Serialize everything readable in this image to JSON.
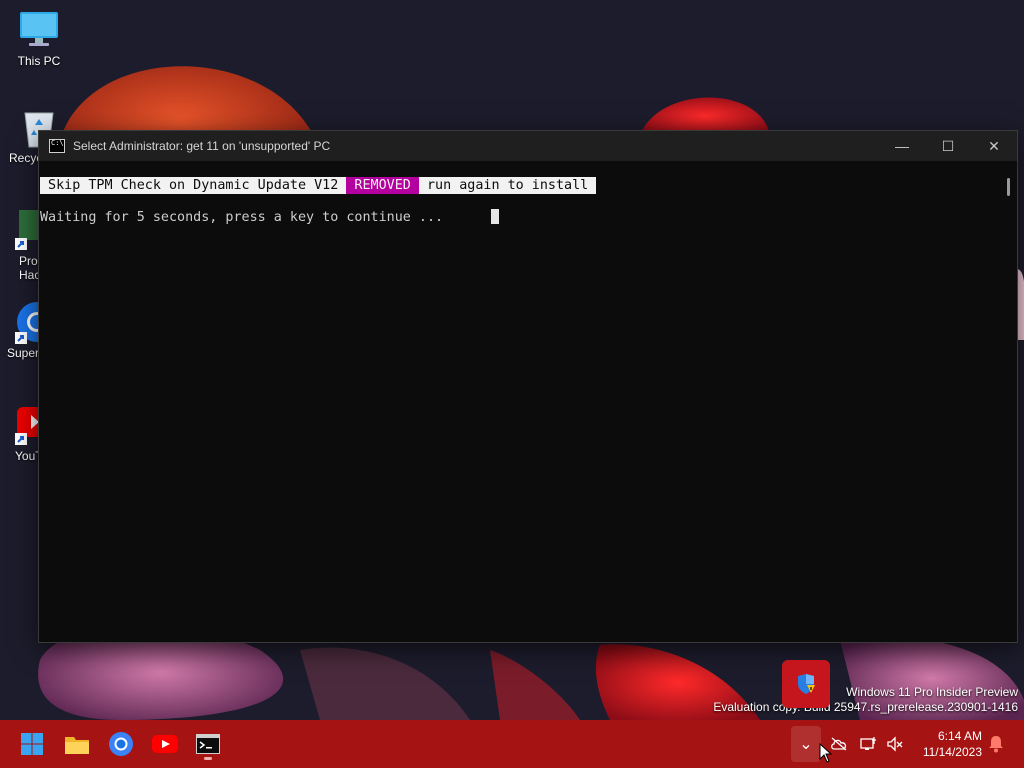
{
  "desktop": {
    "icons": [
      {
        "label": "This PC",
        "icon": "monitor-icon"
      },
      {
        "label": "Recyc",
        "icon": "recycle-bin-icon"
      },
      {
        "label": "Prod Hack",
        "icon": "shortcut-icon"
      },
      {
        "label": "Super",
        "icon": "chrome-icon"
      },
      {
        "label": "YouT",
        "icon": "youtube-icon"
      }
    ]
  },
  "window": {
    "title": "Select Administrator:  get 11 on 'unsupported' PC",
    "buttons": {
      "minimize": "—",
      "maximize": "☐",
      "close": "✕"
    }
  },
  "console": {
    "line1_a": " Skip TPM Check on Dynamic Update V12 ",
    "line1_b": " REMOVED ",
    "line1_c": " run again to install ",
    "line2": "Waiting for 5 seconds, press a key to continue ..."
  },
  "watermark": {
    "line1": "Windows 11 Pro Insider Preview",
    "line2": "Evaluation copy. Build 25947.rs_prerelease.230901-1416"
  },
  "taskbar": {
    "apps": [
      "start-icon",
      "file-explorer-icon",
      "chrome-icon",
      "youtube-icon",
      "terminal-icon"
    ],
    "tray": {
      "chevron": "⌄"
    },
    "clock": {
      "time": "6:14 AM",
      "date": "11/14/2023"
    }
  },
  "colors": {
    "taskbar": "#a51313",
    "console_bg": "#0c0c0c",
    "highlight_magenta": "#b4009e",
    "highlight_white": "#f2f2f2"
  }
}
